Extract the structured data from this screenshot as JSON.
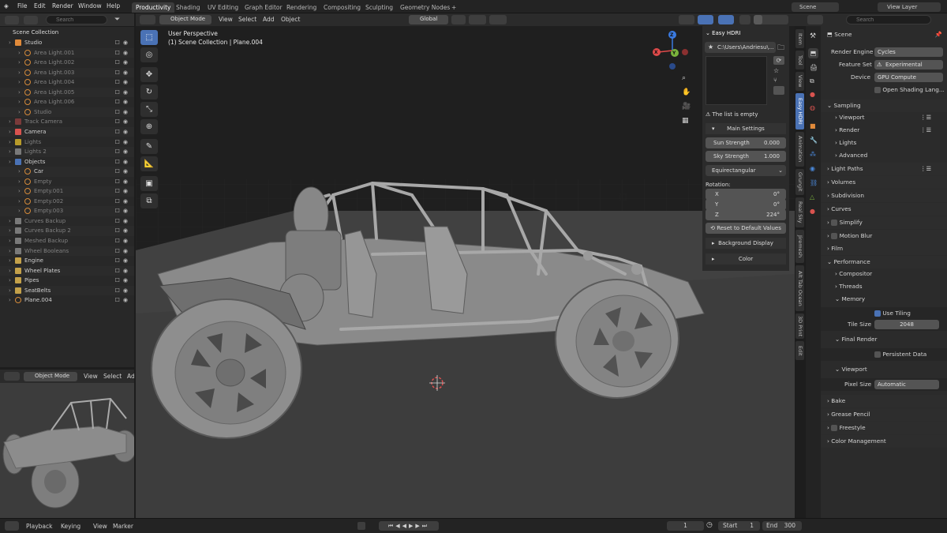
{
  "topbar": {
    "menus": [
      "File",
      "Edit",
      "Render",
      "Window",
      "Help"
    ],
    "workspaces": [
      "Productivity",
      "Shading",
      "UV Editing",
      "Graph Editor",
      "Rendering",
      "Compositing",
      "Sculpting",
      "Geometry Nodes"
    ],
    "add_tab": "+",
    "scene": "Scene",
    "view_layer": "View Layer"
  },
  "outliner": {
    "search_placeholder": "Search",
    "root": "Scene Collection",
    "rows": [
      {
        "label": "Studio",
        "indent": 1,
        "color": "#e08a3a",
        "dim": false
      },
      {
        "label": "Area Light.001",
        "indent": 2,
        "dim": true
      },
      {
        "label": "Area Light.002",
        "indent": 2,
        "dim": true
      },
      {
        "label": "Area Light.003",
        "indent": 2,
        "dim": true
      },
      {
        "label": "Area Light.004",
        "indent": 2,
        "dim": true
      },
      {
        "label": "Area Light.005",
        "indent": 2,
        "dim": true
      },
      {
        "label": "Area Light.006",
        "indent": 2,
        "dim": true
      },
      {
        "label": "Studio",
        "indent": 2,
        "dim": true
      },
      {
        "label": "Track Camera",
        "indent": 1,
        "color": "#7a3a3a",
        "dim": true
      },
      {
        "label": "Camera",
        "indent": 1,
        "color": "#d9534f",
        "dim": false
      },
      {
        "label": "Lights",
        "indent": 1,
        "color": "#b89b2a",
        "dim": true
      },
      {
        "label": "Lights 2",
        "indent": 1,
        "color": "#7a7a7a",
        "dim": true
      },
      {
        "label": "Objects",
        "indent": 1,
        "color": "#4a72b5",
        "dim": false
      },
      {
        "label": "Car",
        "indent": 2,
        "dim": false
      },
      {
        "label": "Empty",
        "indent": 2,
        "dim": true
      },
      {
        "label": "Empty.001",
        "indent": 2,
        "dim": true
      },
      {
        "label": "Empty.002",
        "indent": 2,
        "dim": true
      },
      {
        "label": "Empty.003",
        "indent": 2,
        "dim": true
      },
      {
        "label": "Curves Backup",
        "indent": 1,
        "color": "#7a7a7a",
        "dim": true
      },
      {
        "label": "Curves Backup 2",
        "indent": 1,
        "color": "#7a7a7a",
        "dim": true
      },
      {
        "label": "Meshed Backup",
        "indent": 1,
        "color": "#7a7a7a",
        "dim": true
      },
      {
        "label": "Wheel Booleans",
        "indent": 1,
        "color": "#7a7a7a",
        "dim": true
      },
      {
        "label": "Engine",
        "indent": 1,
        "color": "#c4a14a",
        "dim": false
      },
      {
        "label": "Wheel Plates",
        "indent": 1,
        "color": "#c4a14a",
        "dim": false
      },
      {
        "label": "Pipes",
        "indent": 1,
        "color": "#c4a14a",
        "dim": false
      },
      {
        "label": "SeatBelts",
        "indent": 1,
        "color": "#c4a14a",
        "dim": false
      },
      {
        "label": "Plane.004",
        "indent": 1,
        "dim": false
      }
    ]
  },
  "preview": {
    "mode": "Object Mode",
    "menus": [
      "View",
      "Select",
      "Ad"
    ]
  },
  "viewport": {
    "mode": "Object Mode",
    "menus": [
      "View",
      "Select",
      "Add",
      "Object"
    ],
    "transform": "Global",
    "info_line1": "User Perspective",
    "info_line2": "(1) Scene Collection | Plane.004",
    "gizmo": {
      "x": "X",
      "y": "Y",
      "z": "Z"
    },
    "x_color": "#e04a4a",
    "y_color": "#7ab33c",
    "z_color": "#3a7ae0"
  },
  "hdri": {
    "title": "Easy HDRI",
    "path": "C:\\Users\\Andriesu\\...",
    "empty_msg": "The list is empty",
    "main_settings": "Main Settings",
    "sun_label": "Sun Strength",
    "sun_value": "0.000",
    "sky_label": "Sky Strength",
    "sky_value": "1.000",
    "projection": "Equirectangular",
    "rotation_label": "Rotation:",
    "rot_x_label": "X",
    "rot_x": "0°",
    "rot_y_label": "Y",
    "rot_y": "0°",
    "rot_z_label": "Z",
    "rot_z": "224°",
    "reset": "Reset to Default Values",
    "bg_display": "Background Display",
    "color": "Color"
  },
  "side_tabs": [
    "Item",
    "Tool",
    "View",
    "Easy HDRI",
    "Animation",
    "Grungit",
    "Real Sky",
    "Jiremesh",
    "Alt Tab Ocean",
    "3D Print",
    "Edit"
  ],
  "props": {
    "search_placeholder": "Search",
    "scene_label": "Scene",
    "render_engine_label": "Render Engine",
    "render_engine": "Cycles",
    "feature_set_label": "Feature Set",
    "feature_set": "Experimental",
    "device_label": "Device",
    "device": "GPU Compute",
    "osl": "Open Shading Lang...",
    "sampling": "Sampling",
    "viewport": "Viewport",
    "render": "Render",
    "lights": "Lights",
    "advanced": "Advanced",
    "light_paths": "Light Paths",
    "volumes": "Volumes",
    "subdivision": "Subdivision",
    "curves": "Curves",
    "simplify": "Simplify",
    "motion_blur": "Motion Blur",
    "film": "Film",
    "performance": "Performance",
    "compositor": "Compositor",
    "threads": "Threads",
    "memory": "Memory",
    "use_tiling": "Use Tiling",
    "tile_size_label": "Tile Size",
    "tile_size": "2048",
    "final_render": "Final Render",
    "persistent_data": "Persistent Data",
    "viewport2": "Viewport",
    "pixel_size_label": "Pixel Size",
    "pixel_size": "Automatic",
    "bake": "Bake",
    "grease_pencil": "Grease Pencil",
    "freestyle": "Freestyle",
    "color_mgmt": "Color Management"
  },
  "timeline": {
    "playback": "Playback",
    "keying": "Keying",
    "view": "View",
    "marker": "Marker",
    "current_frame": "1",
    "start_label": "Start",
    "start": "1",
    "end_label": "End",
    "end": "300"
  }
}
